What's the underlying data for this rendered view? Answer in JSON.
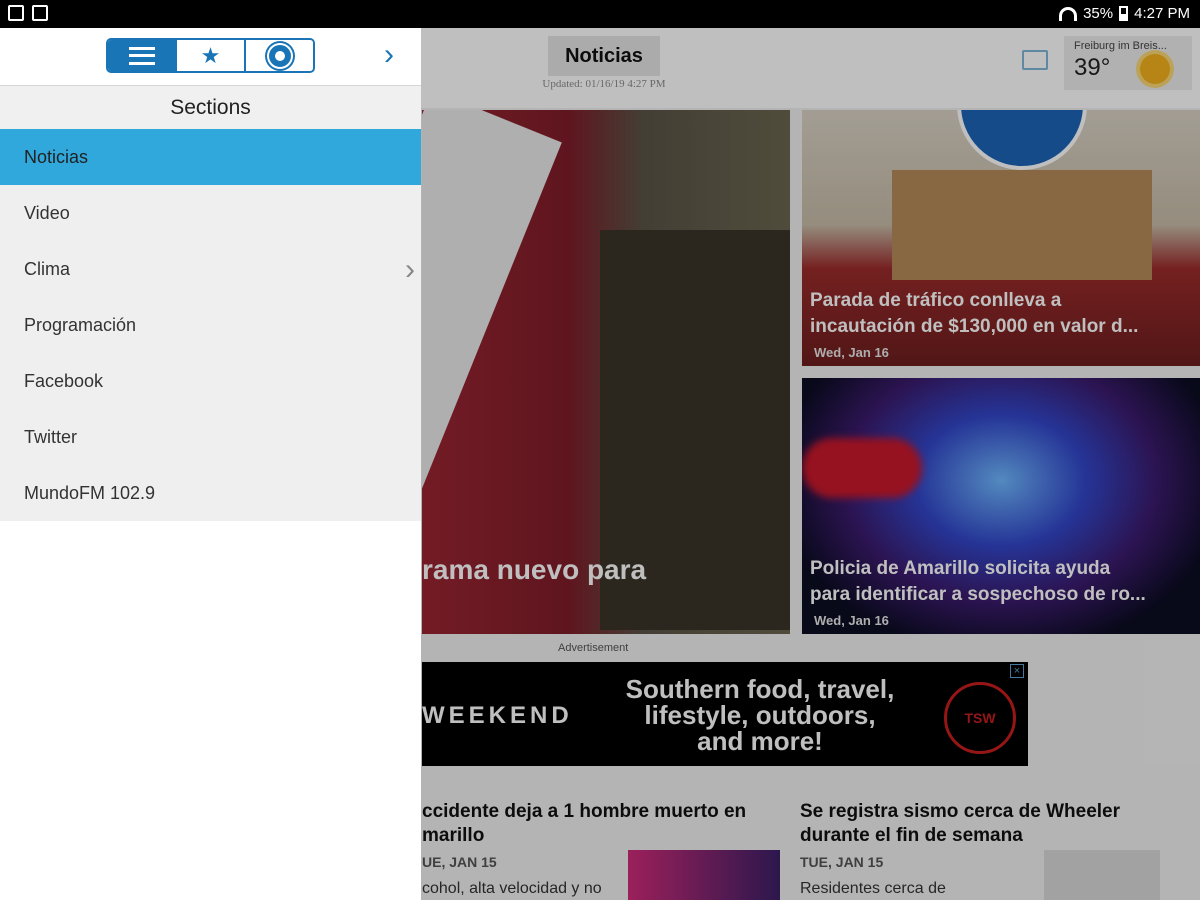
{
  "status_bar": {
    "battery": "35%",
    "time": "4:27 PM"
  },
  "header": {
    "title": "Noticias",
    "updated": "Updated: 01/16/19 4:27 PM",
    "weather": {
      "location": "Freiburg im Breis...",
      "temp": "39°"
    }
  },
  "stories": {
    "hero": {
      "title": "rama nuevo para"
    },
    "s2": {
      "title1": "Parada de tráfico conlleva a",
      "title2": "incautación de $130,000 en valor d...",
      "date": "Wed, Jan 16"
    },
    "s3": {
      "title1": "Policia de Amarillo solicita ayuda",
      "title2": "para identificar a sospechoso de ro...",
      "date": "Wed, Jan 16"
    }
  },
  "ad": {
    "label": "Advertisement",
    "brand": "WEEKEND",
    "line1": "Southern food, travel,",
    "line2": "lifestyle, outdoors,",
    "line3": "and more!",
    "logo": "TSW"
  },
  "bottom_stories": {
    "left": {
      "title1": "ccidente deja a 1 hombre muerto en",
      "title2": "marillo",
      "date": "UE, JAN 15",
      "snippet": "cohol, alta velocidad y no"
    },
    "right": {
      "title1": "Se registra sismo cerca de Wheeler",
      "title2": "durante el fin de semana",
      "date": "TUE, JAN 15",
      "snippet": "Residentes cerca de"
    }
  },
  "drawer": {
    "tabs": [
      {
        "icon": "list-icon",
        "active": true
      },
      {
        "icon": "star-icon",
        "label": "★",
        "active": false
      },
      {
        "icon": "gear-icon",
        "active": false
      }
    ],
    "next_glyph": "›",
    "sections_title": "Sections",
    "items": [
      {
        "label": "Noticias",
        "active": true
      },
      {
        "label": "Video"
      },
      {
        "label": "Clima",
        "has_chevron": true,
        "chevron": "›"
      },
      {
        "label": "Programación"
      },
      {
        "label": "Facebook"
      },
      {
        "label": "Twitter"
      },
      {
        "label": "MundoFM 102.9"
      }
    ]
  },
  "colors": {
    "accent": "#1a75b7",
    "selected": "#31a8dc"
  }
}
